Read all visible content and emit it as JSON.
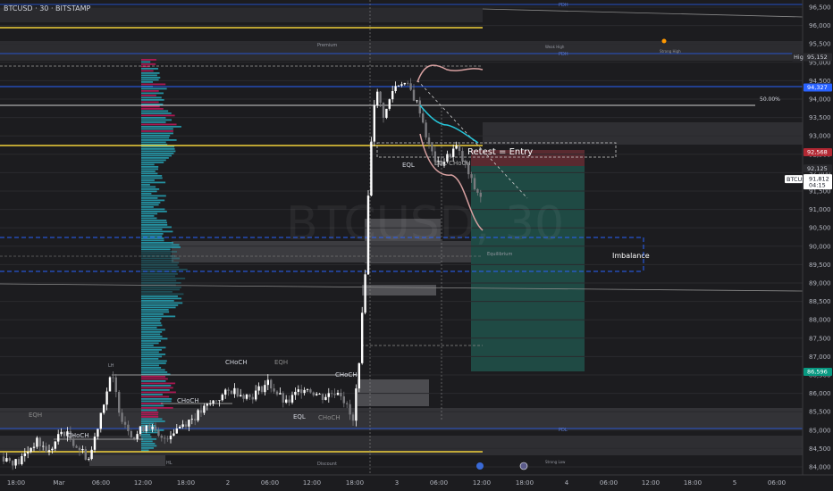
{
  "header": {
    "title": "BTCUSD · 30 · BITSTAMP"
  },
  "colors": {
    "bull": "#ffffff",
    "bear": "#7a7a7e",
    "gold": "#f2d23a",
    "blue": "#2962ff",
    "teal": "#26c6da",
    "red": "#f23645",
    "green": "#089981"
  },
  "chart_data": {
    "type": "candlestick",
    "symbol": "BTCUSD",
    "interval": "30",
    "exchange": "BITSTAMP",
    "watermark": "BTCUSD, 30",
    "y_ticks": [
      96500,
      96000,
      95500,
      95000,
      94500,
      94000,
      93500,
      93000,
      92500,
      92000,
      91500,
      91000,
      90500,
      90000,
      89500,
      89000,
      88500,
      88000,
      87500,
      87000,
      86500,
      86000,
      85500,
      85000,
      84500,
      84000
    ],
    "y_tick_labels": [
      "96,500",
      "96,000",
      "95,500",
      "95,000",
      "94,500",
      "94,000",
      "93,500",
      "93,000",
      "92,500",
      "92,000",
      "91,500",
      "91,000",
      "90,500",
      "90,000",
      "89,500",
      "89,000",
      "88,500",
      "88,000",
      "87,500",
      "87,000",
      "86,500",
      "86,000",
      "85,500",
      "85,000",
      "84,500",
      "84,000"
    ],
    "ylim": [
      83850,
      96900
    ],
    "x_tick_labels": [
      "18:00",
      "Mar",
      "06:00",
      "12:00",
      "18:00",
      "2",
      "06:00",
      "12:00",
      "18:00",
      "3",
      "06:00",
      "12:00",
      "18:00",
      "4",
      "06:00",
      "12:00",
      "18:00",
      "5",
      "06:00"
    ],
    "price_labels": [
      {
        "text": "High",
        "value": 95152,
        "style": "dark"
      },
      {
        "text": "95,152",
        "value": 95152,
        "style": "dark"
      },
      {
        "text": "94,327",
        "value": 94327,
        "style": "blue"
      },
      {
        "text": "92,568",
        "value": 92568,
        "style": "red"
      },
      {
        "text": "92,125",
        "value": 92125,
        "style": "dark"
      },
      {
        "text": "BTCUSD",
        "value": 91812,
        "style": "light"
      },
      {
        "text": "91,812",
        "value": 91812,
        "style": "light"
      },
      {
        "text": "04:15",
        "value": 91812,
        "style": "light"
      },
      {
        "text": "86,596",
        "value": 86596,
        "style": "green"
      }
    ],
    "candles_hint": "approximate OHLC path read from chart",
    "key_path": [
      [
        0,
        84300
      ],
      [
        20,
        84100
      ],
      [
        40,
        84700
      ],
      [
        55,
        84400
      ],
      [
        70,
        85000
      ],
      [
        85,
        84600
      ],
      [
        100,
        84200
      ],
      [
        115,
        85700
      ],
      [
        125,
        86500
      ],
      [
        135,
        85400
      ],
      [
        150,
        84800
      ],
      [
        165,
        85200
      ],
      [
        180,
        84700
      ],
      [
        200,
        85100
      ],
      [
        220,
        85400
      ],
      [
        240,
        85800
      ],
      [
        260,
        86100
      ],
      [
        280,
        85900
      ],
      [
        300,
        86300
      ],
      [
        320,
        85700
      ],
      [
        340,
        86200
      ],
      [
        360,
        85900
      ],
      [
        380,
        86100
      ],
      [
        395,
        85200
      ],
      [
        402,
        87000
      ],
      [
        408,
        89000
      ],
      [
        414,
        92500
      ],
      [
        420,
        94300
      ],
      [
        430,
        93500
      ],
      [
        440,
        94300
      ],
      [
        450,
        94500
      ],
      [
        460,
        94200
      ],
      [
        470,
        93700
      ],
      [
        480,
        92700
      ],
      [
        490,
        92200
      ],
      [
        500,
        92400
      ],
      [
        510,
        92700
      ],
      [
        520,
        92200
      ],
      [
        530,
        91600
      ],
      [
        540,
        91300
      ]
    ],
    "annotations": {
      "retest": "Retest = Entry",
      "imbalance": "Imbalance",
      "fifty": "50.00%",
      "premium": "Premium",
      "discount": "Discount",
      "equilibrium": "Equilibrium",
      "choch": "CHoCH",
      "eqh": "EQH",
      "eql": "EQL",
      "eql_choch": "EQL CHoCH",
      "pdh": "PDH",
      "pdl": "PDL",
      "hl": "HL",
      "lh": "LH",
      "strong_low": "Strong Low",
      "weak_high": "Weak High",
      "strong_high": "Strong High"
    }
  }
}
